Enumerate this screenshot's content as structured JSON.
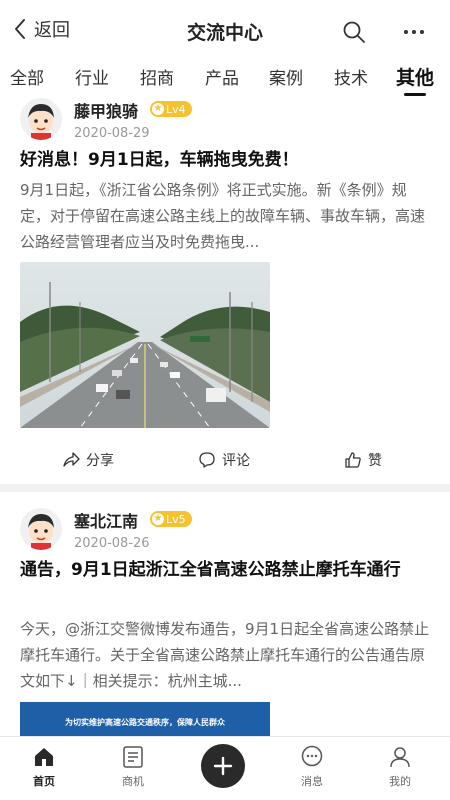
{
  "header": {
    "back_label": "返回",
    "title": "交流中心"
  },
  "tabs": [
    {
      "label": "全部"
    },
    {
      "label": "行业"
    },
    {
      "label": "招商"
    },
    {
      "label": "产品"
    },
    {
      "label": "案例"
    },
    {
      "label": "技术"
    },
    {
      "label": "其他",
      "active": true
    }
  ],
  "posts": [
    {
      "author": "藤甲狼骑",
      "level": "Lv4",
      "date": "2020-08-29",
      "title": "好消息！9月1日起，车辆拖曳免费！",
      "body": "9月1日起，《浙江省公路条例》将正式实施。新《条例》规定，对于停留在高速公路主线上的故障车辆、事故车辆，高速公路经营管理者应当及时免费拖曳...",
      "image": "highway-photo"
    },
    {
      "author": "塞北江南",
      "level": "Lv5",
      "date": "2020-08-26",
      "title": "通告，9月1日起浙江全省高速公路禁止摩托车通行",
      "body": "今天，@浙江交警微博发布通告，9月1日起全省高速公路禁止摩托车通行。关于全省高速公路禁止摩托车通行的公告通告原文如下↓｜相关提示：杭州主城...",
      "banner_text": "为切实维护高速公路交通秩序，保障人民群众"
    }
  ],
  "actions": {
    "share": "分享",
    "comment": "评论",
    "like": "赞"
  },
  "bottom_nav": [
    {
      "label": "首页",
      "icon": "home-icon",
      "active": true
    },
    {
      "label": "商机",
      "icon": "document-icon"
    },
    {
      "label": "",
      "icon": "plus-icon"
    },
    {
      "label": "消息",
      "icon": "chat-icon"
    },
    {
      "label": "我的",
      "icon": "person-icon"
    }
  ],
  "colors": {
    "level_badge": "#f6c231",
    "active_tab_underline": "#111111",
    "plus_button": "#2a2a2a"
  }
}
